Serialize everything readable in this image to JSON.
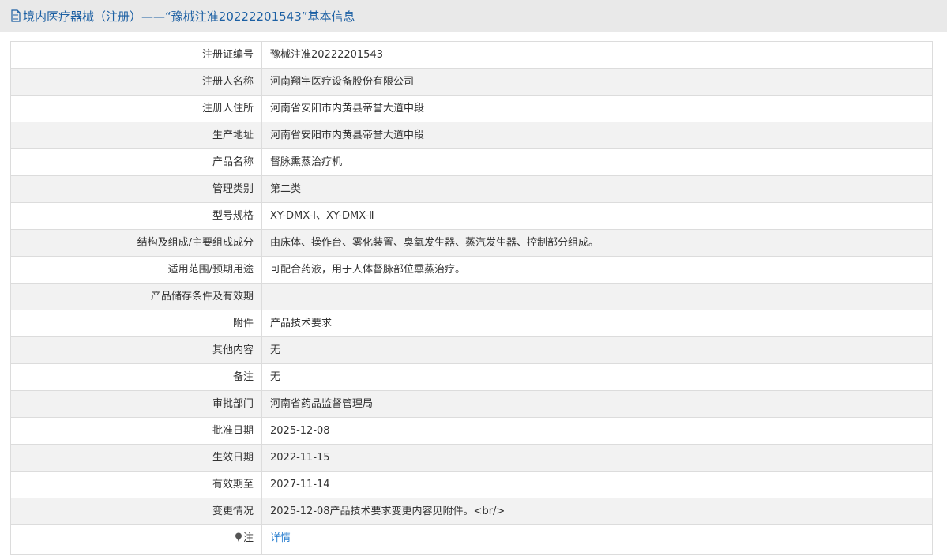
{
  "header": {
    "icon": "document-icon",
    "title": "境内医疗器械（注册）——“豫械注准20222201543”基本信息"
  },
  "rows": [
    {
      "label": "注册证编号",
      "value": "豫械注准20222201543"
    },
    {
      "label": "注册人名称",
      "value": "河南翔宇医疗设备股份有限公司"
    },
    {
      "label": "注册人住所",
      "value": "河南省安阳市内黄县帝誉大道中段"
    },
    {
      "label": "生产地址",
      "value": "河南省安阳市内黄县帝誉大道中段"
    },
    {
      "label": "产品名称",
      "value": "督脉熏蒸治疗机"
    },
    {
      "label": "管理类别",
      "value": "第二类"
    },
    {
      "label": "型号规格",
      "value": "XY-DMX-Ⅰ、XY-DMX-Ⅱ"
    },
    {
      "label": "结构及组成/主要组成成分",
      "value": "由床体、操作台、雾化装置、臭氧发生器、蒸汽发生器、控制部分组成。"
    },
    {
      "label": "适用范围/预期用途",
      "value": "可配合药液，用于人体督脉部位熏蒸治疗。"
    },
    {
      "label": "产品储存条件及有效期",
      "value": ""
    },
    {
      "label": "附件",
      "value": "产品技术要求"
    },
    {
      "label": "其他内容",
      "value": "无"
    },
    {
      "label": "备注",
      "value": "无"
    },
    {
      "label": "审批部门",
      "value": "河南省药品监督管理局"
    },
    {
      "label": "批准日期",
      "value": "2025-12-08"
    },
    {
      "label": "生效日期",
      "value": "2022-11-15"
    },
    {
      "label": "有效期至",
      "value": "2027-11-14"
    },
    {
      "label": "变更情况",
      "value": "2025-12-08产品技术要求变更内容见附件。<br/>"
    }
  ],
  "note": {
    "icon": "pin-icon",
    "label": "注",
    "link": "详情"
  },
  "colors": {
    "header_bg": "#e9e9e9",
    "title": "#1b5fa3",
    "link": "#2a7fd0",
    "row_alt": "#f2f2f2",
    "border": "#dcdcdc"
  }
}
